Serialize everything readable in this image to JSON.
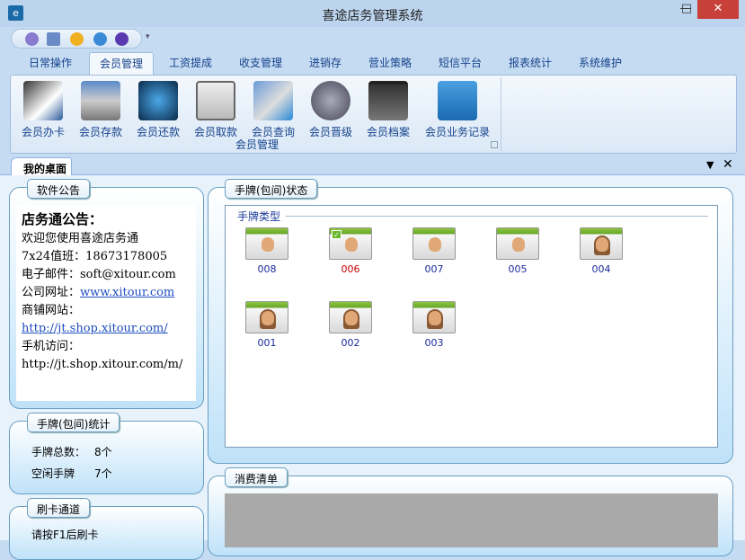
{
  "window": {
    "title": "喜途店务管理系统",
    "minimize": "—",
    "maximize": "□",
    "close": "✕"
  },
  "quick_access": [
    "book-icon",
    "printer-icon",
    "smiley-icon",
    "ie-icon",
    "moon-icon"
  ],
  "tabs": [
    "日常操作",
    "会员管理",
    "工资提成",
    "收支管理",
    "进销存",
    "营业策略",
    "短信平台",
    "报表统计",
    "系统维护"
  ],
  "ribbon": {
    "group_label": "会员管理",
    "buttons": [
      "会员办卡",
      "会员存款",
      "会员还款",
      "会员取款",
      "会员查询",
      "会员晋级",
      "会员档案",
      "会员业务记录"
    ]
  },
  "doc_tab": "我的桌面",
  "notice": {
    "label": "软件公告",
    "heading": "店务通公告：",
    "lines": [
      "欢迎您使用喜途店务通",
      "7x24值班：18673178005",
      "电子邮件：soft@xitour.com"
    ],
    "site_label": "公司网址：",
    "site_link": "www.xitour.com",
    "shop_label": "商铺网站：",
    "shop_link": "http://jt.shop.xitour.com/",
    "mobile_label": "手机访问：",
    "mobile_url": "http://jt.shop.xitour.com/m/"
  },
  "stats": {
    "label": "手牌(包间)统计",
    "total_label": "手牌总数：",
    "total": "8个",
    "idle_label": "空闲手牌",
    "idle": "7个"
  },
  "card_channel": {
    "label": "刷卡通道",
    "hint": "请按F1后刷卡"
  },
  "status": {
    "label": "手牌(包间)状态",
    "group_label": "手牌类型",
    "cards": [
      {
        "num": "008",
        "gender": "male",
        "occupied": false
      },
      {
        "num": "006",
        "gender": "male",
        "occupied": true
      },
      {
        "num": "007",
        "gender": "male",
        "occupied": false
      },
      {
        "num": "005",
        "gender": "male",
        "occupied": false
      },
      {
        "num": "004",
        "gender": "female",
        "occupied": false
      },
      {
        "num": "001",
        "gender": "female",
        "occupied": false
      },
      {
        "num": "002",
        "gender": "female",
        "occupied": false
      },
      {
        "num": "003",
        "gender": "female",
        "occupied": false
      }
    ]
  },
  "consumption": {
    "label": "消费清单"
  }
}
